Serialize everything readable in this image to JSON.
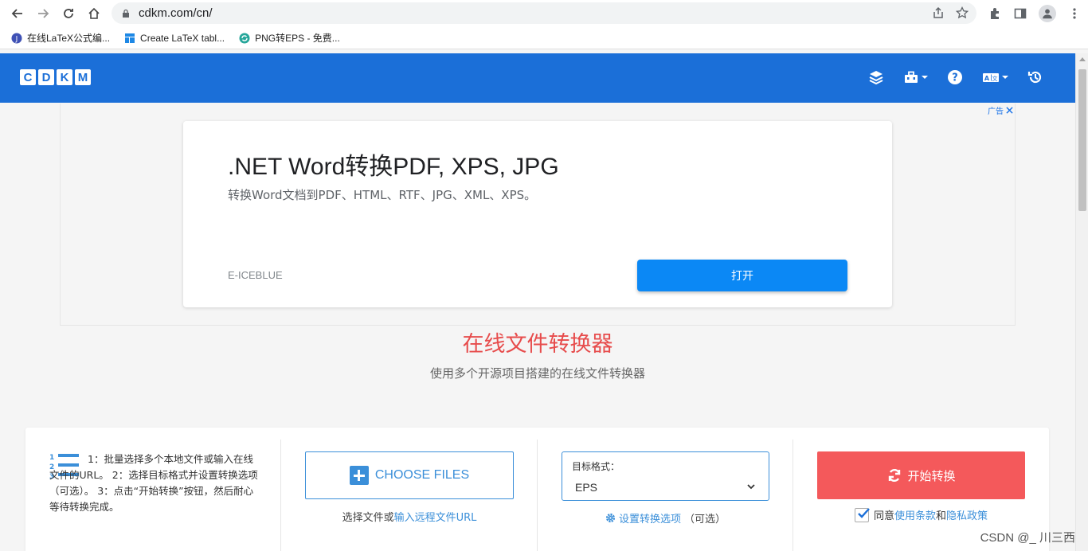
{
  "browser": {
    "url": "cdkm.com/cn/",
    "bookmarks": [
      {
        "label": "在线LaTeX公式编..."
      },
      {
        "label": "Create LaTeX tabl..."
      },
      {
        "label": "PNG转EPS - 免费..."
      }
    ]
  },
  "site": {
    "logo_letters": [
      "C",
      "D",
      "K",
      "M"
    ]
  },
  "ad": {
    "badge": "广告",
    "title": ".NET Word转换PDF, XPS, JPG",
    "description": "转换Word文档到PDF、HTML、RTF、JPG、XML、XPS。",
    "brand": "E-ICEBLUE",
    "open_button": "打开"
  },
  "hero": {
    "title": "在线文件转换器",
    "subtitle": "使用多个开源项目搭建的在线文件转换器"
  },
  "converter": {
    "steps_text": "1：批量选择多个本地文件或输入在线文件的URL。 2：选择目标格式并设置转换选项（可选）。 3：点击“开始转换”按钮，然后耐心等待转换完成。",
    "choose_files": "CHOOSE FILES",
    "choose_hint_prefix": "选择文件或",
    "choose_hint_link": "输入远程文件URL",
    "format_label": "目标格式：",
    "format_value": "EPS",
    "options_link": "设置转换选项",
    "options_suffix": "（可选）",
    "start_button": "开始转换",
    "agree_prefix": "同意",
    "terms_link": "使用条款",
    "agree_and": "和",
    "privacy_link": "隐私政策"
  },
  "watermark": "CSDN @_ 川三西",
  "colors": {
    "header": "#1b6fd8",
    "accent": "#3b8fd9",
    "start": "#f4595b",
    "hero_title": "#e74c4c"
  }
}
